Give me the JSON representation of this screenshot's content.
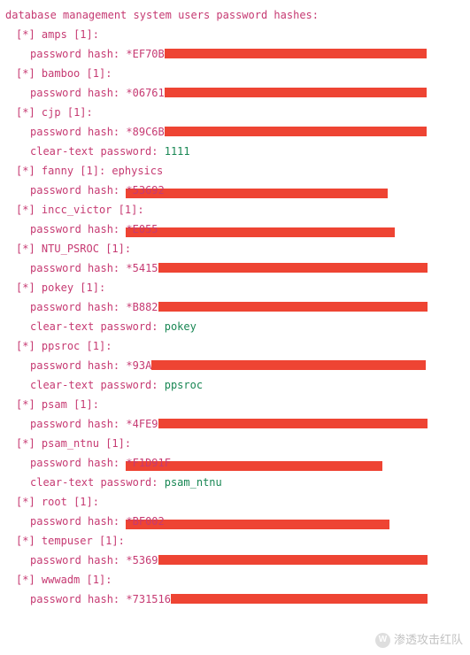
{
  "header": "database management system users password hashes:",
  "marker": "[*]",
  "count_suffix": "[1]:",
  "label": {
    "password_hash": "password hash:",
    "clear_text": "clear-text password:"
  },
  "users": [
    {
      "name": "amps",
      "note": "",
      "hash_prefix": "*EF70B",
      "redact_w": 296,
      "cleartext": null
    },
    {
      "name": "bamboo",
      "note": "",
      "hash_prefix": "*06761",
      "redact_w": 296,
      "cleartext": null
    },
    {
      "name": "cjp",
      "note": "",
      "hash_prefix": "*89C6B",
      "redact_w": 296,
      "cleartext": "1111"
    },
    {
      "name": "fanny",
      "note": "ephysics",
      "hash_prefix": "*53692",
      "redact_w": 296,
      "cleartext": null,
      "overlap": true,
      "overlap_text": "",
      "overlap_full": "*53692"
    },
    {
      "name": "incc_victor",
      "note": "",
      "hash_prefix": "*E055",
      "redact_w": 304,
      "cleartext": null,
      "overlap": true
    },
    {
      "name": "NTU_PSROC",
      "note": "",
      "hash_prefix": "*5415",
      "redact_w": 304,
      "cleartext": null
    },
    {
      "name": "pokey",
      "note": "",
      "hash_prefix": "*B882",
      "redact_w": 304,
      "cleartext": "pokey"
    },
    {
      "name": "ppsroc",
      "note": "",
      "hash_prefix": "*93A",
      "redact_w": 310,
      "cleartext": "ppsroc"
    },
    {
      "name": "psam",
      "note": "",
      "hash_prefix": "*4FE9",
      "redact_w": 304,
      "cleartext": null
    },
    {
      "name": "psam_ntnu",
      "note": "",
      "hash_prefix": "*F1D91F",
      "redact_w": 290,
      "cleartext": "psam_ntnu",
      "overlap": true
    },
    {
      "name": "root",
      "note": "",
      "hash_prefix": "*BF002",
      "redact_w": 298,
      "cleartext": null,
      "overlap": true
    },
    {
      "name": "tempuser",
      "note": "",
      "hash_prefix": "*5369",
      "redact_w": 304,
      "cleartext": null
    },
    {
      "name": "wwwadm",
      "note": "",
      "hash_prefix": "*731516",
      "redact_w": 290,
      "cleartext": null
    }
  ],
  "watermark": {
    "icon": "W",
    "text": "渗透攻击红队"
  }
}
